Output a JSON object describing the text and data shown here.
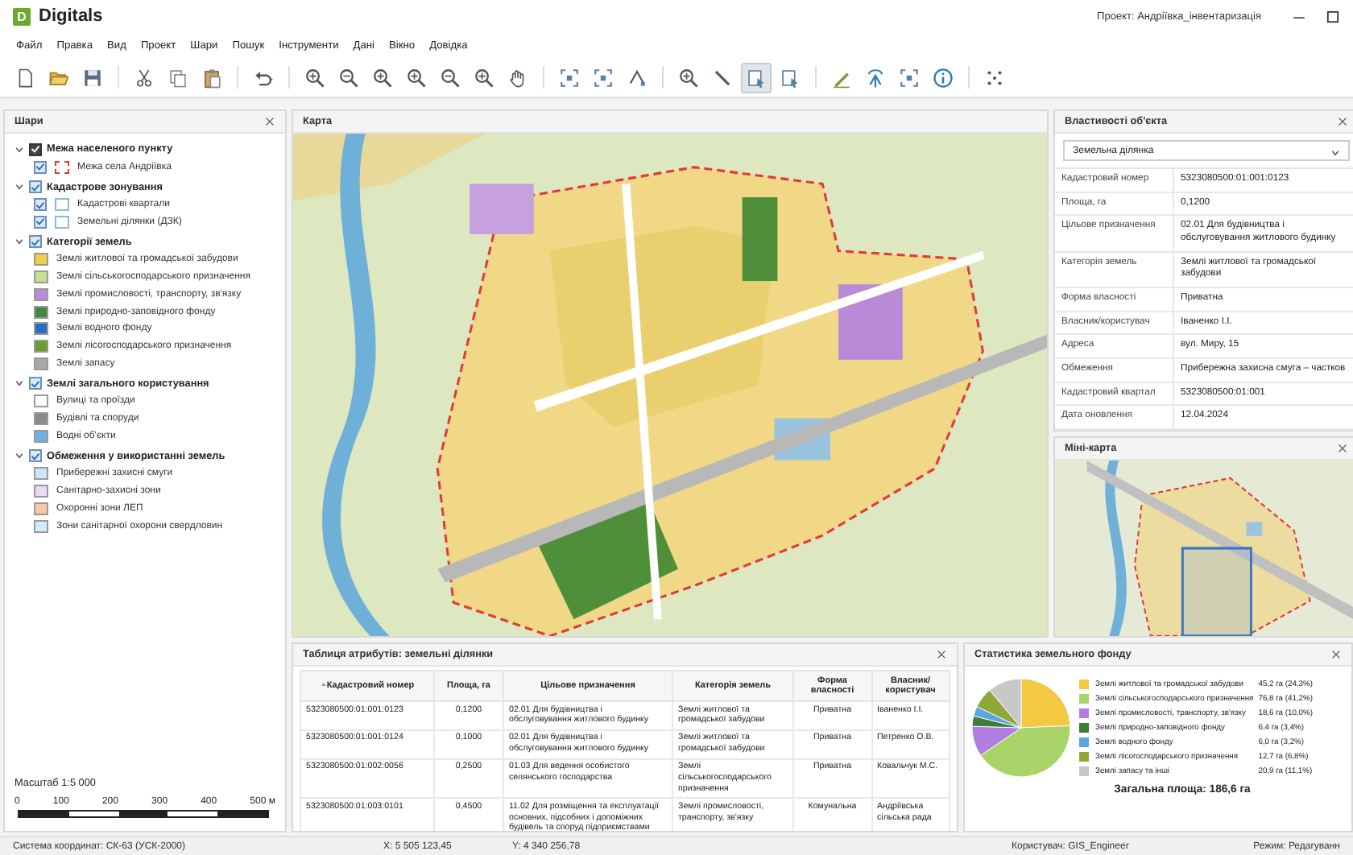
{
  "window": {
    "logo": "D",
    "title": "Digitals",
    "project": "Проект: Андріївка_інвентаризація"
  },
  "menu": [
    "Файл",
    "Правка",
    "Вид",
    "Проект",
    "Шари",
    "Пошук",
    "Інструменти",
    "Дані",
    "Вікно",
    "Довідка"
  ],
  "toolbar": [
    {
      "kind": "new",
      "selected": false
    },
    {
      "kind": "open",
      "selected": false
    },
    {
      "kind": "save",
      "selected": false
    },
    {
      "kind": "sep"
    },
    {
      "kind": "cut",
      "selected": false
    },
    {
      "kind": "copy",
      "selected": false
    },
    {
      "kind": "paste",
      "selected": false
    },
    {
      "kind": "sep"
    },
    {
      "kind": "undo",
      "selected": false
    },
    {
      "kind": "sep"
    },
    {
      "kind": "zoom-in",
      "selected": false
    },
    {
      "kind": "zoom-out",
      "selected": false
    },
    {
      "kind": "zoom-in",
      "selected": false
    },
    {
      "kind": "zoom-in",
      "selected": false
    },
    {
      "kind": "zoom-out",
      "selected": false
    },
    {
      "kind": "zoom-in",
      "selected": false
    },
    {
      "kind": "pan",
      "selected": false
    },
    {
      "kind": "sep"
    },
    {
      "kind": "extent",
      "selected": false
    },
    {
      "kind": "extent",
      "selected": false
    },
    {
      "kind": "node",
      "selected": false
    },
    {
      "kind": "sep"
    },
    {
      "kind": "zoom-in",
      "selected": false
    },
    {
      "kind": "line",
      "selected": false
    },
    {
      "kind": "select",
      "selected": true
    },
    {
      "kind": "select",
      "selected": false
    },
    {
      "kind": "sep"
    },
    {
      "kind": "pen",
      "selected": false
    },
    {
      "kind": "antenna",
      "selected": false
    },
    {
      "kind": "extent",
      "selected": false
    },
    {
      "kind": "info",
      "selected": false
    },
    {
      "kind": "sep"
    },
    {
      "kind": "scatter",
      "selected": false
    }
  ],
  "layers": {
    "title": "Шари",
    "groups": [
      {
        "label": "Межа населеного пункту",
        "checked": true,
        "expanded": true,
        "children": [
          {
            "kind": "boundary",
            "label": "Межа села Андріївка",
            "checked": true,
            "color": "#e03a3a"
          }
        ]
      },
      {
        "label": "Кадастрове зонування",
        "checked": true,
        "expanded": true,
        "children": [
          {
            "kind": "outline",
            "label": "Кадастрові квартали",
            "checked": true,
            "color": "#8fb8e0"
          },
          {
            "kind": "outline",
            "label": "Земельні ділянки (ДЗК)",
            "checked": true,
            "color": "#8fb8e0"
          }
        ]
      },
      {
        "label": "Категорії земель",
        "checked": true,
        "expanded": true,
        "children": [
          {
            "kind": "fill",
            "label": "Землі житлової та громадської забудови",
            "color": "#f2cf4a"
          },
          {
            "kind": "fill",
            "label": "Землі сільськогосподарського призначення",
            "color": "#c6df8c"
          },
          {
            "kind": "fill",
            "label": "Землі промисловості, транспорту, зв'язку",
            "color": "#b88ad8"
          },
          {
            "kind": "fill",
            "label": "Землі природно-заповідного фонду",
            "color": "#3f8a3a"
          },
          {
            "kind": "fill",
            "label": "Землі водного фонду",
            "color": "#2a6cbf"
          },
          {
            "kind": "fill",
            "label": "Землі лісогосподарського призначення",
            "color": "#6b9f2a"
          },
          {
            "kind": "fill",
            "label": "Землі запасу",
            "color": "#a8a8a8"
          }
        ]
      },
      {
        "label": "Землі загального користування",
        "checked": true,
        "expanded": true,
        "children": [
          {
            "kind": "fill",
            "label": "Вулиці та проїзди",
            "color": "#ffffff"
          },
          {
            "kind": "fill",
            "label": "Будівлі та споруди",
            "color": "#8a8a8a"
          },
          {
            "kind": "fill",
            "label": "Водні об'єкти",
            "color": "#6fb0e6"
          }
        ]
      },
      {
        "label": "Обмеження у використанні земель",
        "checked": true,
        "expanded": true,
        "children": [
          {
            "kind": "fill",
            "label": "Прибережні захисні смуги",
            "color": "#cfe5f6"
          },
          {
            "kind": "fill",
            "label": "Санітарно-захисні зони",
            "color": "#ecd9f2"
          },
          {
            "kind": "fill",
            "label": "Охоронні зони ЛЕП",
            "color": "#f8c9a0"
          },
          {
            "kind": "fill",
            "label": "Зони санітарної охорони свердловин",
            "color": "#d3ebf7"
          }
        ]
      }
    ],
    "scale": "Масштаб 1:5 000",
    "scale_ticks": [
      "0",
      "100",
      "200",
      "300",
      "400",
      "500 м"
    ]
  },
  "map": {
    "title": "Карта"
  },
  "properties": {
    "title": "Властивості об'єкта",
    "object_type": "Земельна ділянка",
    "rows": [
      {
        "label": "Кадастровий номер",
        "value": "5323080500:01:001:0123"
      },
      {
        "label": "Площа, га",
        "value": "0,1200"
      },
      {
        "label": "Цільове призначення",
        "value": "02.01 Для будівництва і обслуговування житлового будинку"
      },
      {
        "label": "Категорія земель",
        "value": "Землі житлової та громадської забудови"
      },
      {
        "label": "Форма власності",
        "value": "Приватна"
      },
      {
        "label": "Власник/користувач",
        "value": "Іваненко І.І."
      },
      {
        "label": "Адреса",
        "value": "вул. Миру, 15"
      },
      {
        "label": "Обмеження",
        "value": "Прибережна захисна смуга – частков"
      },
      {
        "label": "Кадастровий квартал",
        "value": "5323080500:01:001"
      },
      {
        "label": "Дата оновлення",
        "value": "12.04.2024"
      }
    ]
  },
  "minimap": {
    "title": "Міні-карта"
  },
  "attribute_table": {
    "title": "Таблиця атрибутів: земельні ділянки",
    "columns": [
      "Кадастровий номер",
      "Площа, га",
      "Цільове призначення",
      "Категорія земель",
      "Форма власності",
      "Власник/користувач"
    ],
    "rows": [
      [
        "5323080500:01:001:0123",
        "0,1200",
        "02.01 Для будівництва і обслуговування житлового будинку",
        "Землі житлової та громадської забудови",
        "Приватна",
        "Іваненко І.І."
      ],
      [
        "5323080500:01:001:0124",
        "0,1000",
        "02.01 Для будівництва і обслуговування житлового будинку",
        "Землі житлової та громадської забудови",
        "Приватна",
        "Петренко О.В."
      ],
      [
        "5323080500:01:002:0056",
        "0,2500",
        "01.03 Для ведення особистого селянського господарства",
        "Землі сільськогосподарського призначення",
        "Приватна",
        "Ковальчук М.С."
      ],
      [
        "5323080500:01:003:0101",
        "0,4500",
        "11.02 Для розміщення та експлуатації основних, підсобних і допоміжних будівель та споруд підприємствами",
        "Землі промисловості, транспорту, зв'язку",
        "Комунальна",
        "Андріївська сільська рада"
      ]
    ]
  },
  "statistics": {
    "title": "Статистика земельного фонду",
    "chart_data": {
      "type": "pie",
      "categories": [
        "Землі житлової та громадської забудови",
        "Землі сільськогосподарського призначення",
        "Землі промисловості, транспорту, зв'язку",
        "Землі природно-заповідного фонду",
        "Землі водного фонду",
        "Землі лісогосподарського призначення",
        "Землі запасу та інші"
      ],
      "values": [
        24.3,
        41.2,
        10.0,
        3.4,
        3.2,
        6.8,
        11.1
      ],
      "colors": [
        "#f5c842",
        "#a9d46a",
        "#b07ee0",
        "#3e7d34",
        "#5aa7e0",
        "#8fa83a",
        "#c8c8c8"
      ],
      "value_labels": [
        "45,2 га (24,3%)",
        "76,8 га (41,2%)",
        "18,6 га (10,0%)",
        "6,4 га (3,4%)",
        "6,0 га (3,2%)",
        "12,7 га (6,8%)",
        "20,9 га (11,1%)"
      ]
    },
    "total": "Загальна площа: 186,6 га"
  },
  "status_bar": [
    "Система координат: СК-63 (УСК-2000)",
    "X: 5 505 123,45",
    "Y: 4 340 256,78",
    "Користувач: GIS_Engineer",
    "Режим: Редагуванн"
  ]
}
